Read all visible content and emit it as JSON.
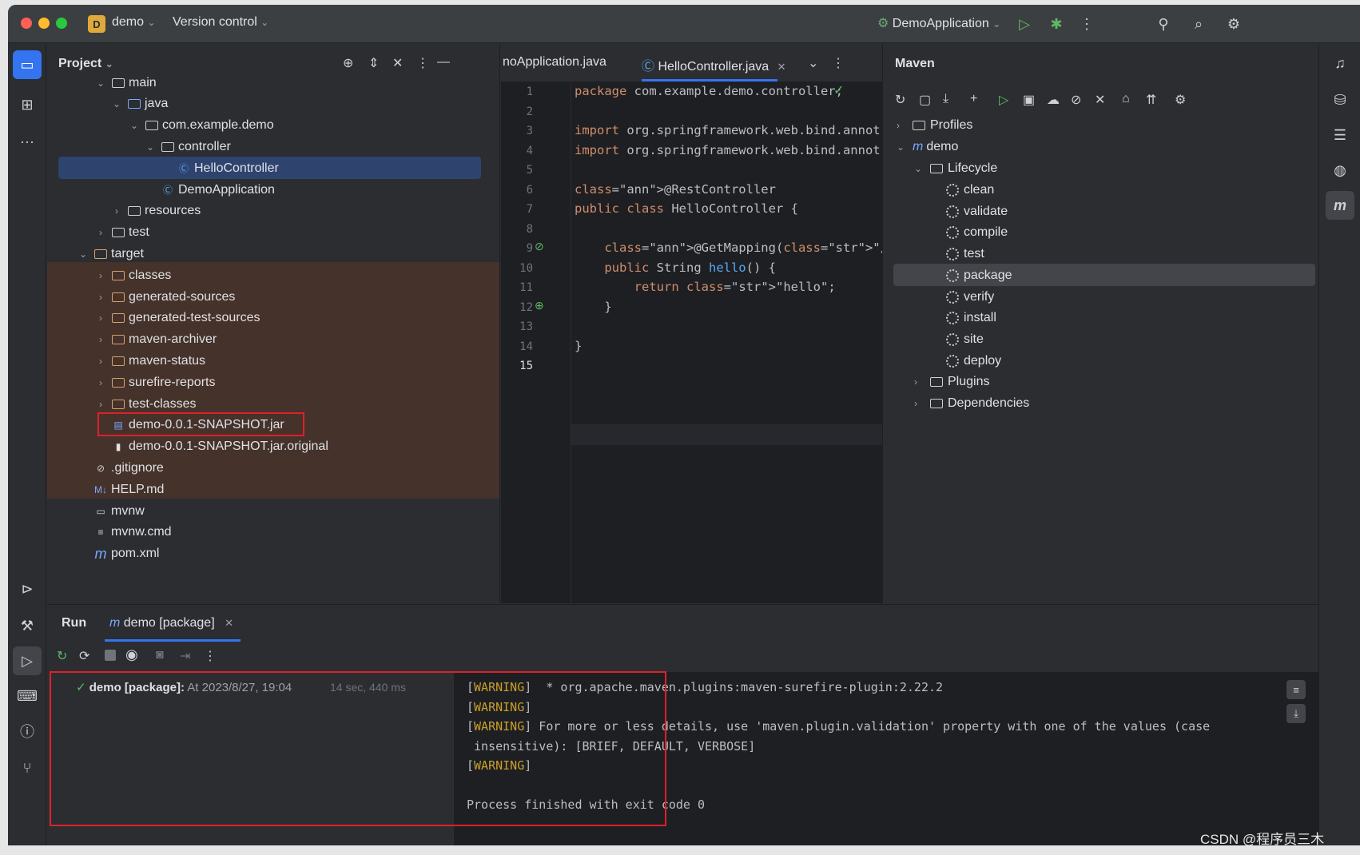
{
  "titlebar": {
    "project_badge": "D",
    "project_name": "demo",
    "vcs": "Version control",
    "run_config": "DemoApplication"
  },
  "project_panel": {
    "title": "Project",
    "tree": [
      {
        "label": "main",
        "indent": 0
      },
      {
        "label": "java",
        "indent": 1
      },
      {
        "label": "com.example.demo",
        "indent": 2
      },
      {
        "label": "controller",
        "indent": 3
      },
      {
        "label": "HelloController",
        "indent": 4,
        "selected": true
      },
      {
        "label": "DemoApplication",
        "indent": 3
      },
      {
        "label": "resources",
        "indent": 1
      },
      {
        "label": "test",
        "indent": 0
      },
      {
        "label": "target",
        "indent": -1
      },
      {
        "label": "classes",
        "indent": 0
      },
      {
        "label": "generated-sources",
        "indent": 0
      },
      {
        "label": "generated-test-sources",
        "indent": 0
      },
      {
        "label": "maven-archiver",
        "indent": 0
      },
      {
        "label": "maven-status",
        "indent": 0
      },
      {
        "label": "surefire-reports",
        "indent": 0
      },
      {
        "label": "test-classes",
        "indent": 0
      },
      {
        "label": "demo-0.0.1-SNAPSHOT.jar",
        "indent": 0
      },
      {
        "label": "demo-0.0.1-SNAPSHOT.jar.original",
        "indent": 0
      },
      {
        "label": ".gitignore",
        "indent": -1
      },
      {
        "label": "HELP.md",
        "indent": -1
      },
      {
        "label": "mvnw",
        "indent": -1
      },
      {
        "label": "mvnw.cmd",
        "indent": -1
      },
      {
        "label": "pom.xml",
        "indent": -1
      }
    ]
  },
  "editor": {
    "tabs": [
      "noApplication.java",
      "HelloController.java"
    ],
    "lines": [
      {
        "n": "1",
        "text": "package com.example.demo.controller;"
      },
      {
        "n": "2",
        "text": ""
      },
      {
        "n": "3",
        "text": "import org.springframework.web.bind.annot"
      },
      {
        "n": "4",
        "text": "import org.springframework.web.bind.annot"
      },
      {
        "n": "5",
        "text": ""
      },
      {
        "n": "6",
        "text": "@RestController"
      },
      {
        "n": "7",
        "text": "public class HelloController {"
      },
      {
        "n": "8",
        "text": ""
      },
      {
        "n": "9",
        "text": "    @GetMapping(\"/hello\")"
      },
      {
        "n": "10",
        "text": "    public String hello() {"
      },
      {
        "n": "11",
        "text": "        return \"hello\";"
      },
      {
        "n": "12",
        "text": "    }"
      },
      {
        "n": "13",
        "text": ""
      },
      {
        "n": "14",
        "text": "}"
      },
      {
        "n": "15",
        "text": ""
      }
    ]
  },
  "maven": {
    "title": "Maven",
    "profiles": "Profiles",
    "project": "demo",
    "lifecycle": "Lifecycle",
    "goals": [
      "clean",
      "validate",
      "compile",
      "test",
      "package",
      "verify",
      "install",
      "site",
      "deploy"
    ],
    "selected_goal": "package",
    "plugins": "Plugins",
    "dependencies": "Dependencies"
  },
  "run": {
    "tab_run": "Run",
    "tab_config": "demo [package]",
    "result_label": "demo [package]:",
    "result_time": "At 2023/8/27, 19:04",
    "duration": "14 sec, 440 ms",
    "console": [
      {
        "tag": "[WARNING]",
        "text": "  * org.apache.maven.plugins:maven-surefire-plugin:2.22.2"
      },
      {
        "tag": "[WARNING]",
        "text": ""
      },
      {
        "tag": "[WARNING]",
        "text": " For more or less details, use 'maven.plugin.validation' property with one of the values (case"
      },
      {
        "tag": "",
        "text": " insensitive): [BRIEF, DEFAULT, VERBOSE]"
      },
      {
        "tag": "[WARNING]",
        "text": ""
      },
      {
        "tag": "",
        "text": ""
      },
      {
        "tag": "",
        "text": "Process finished with exit code 0"
      }
    ]
  },
  "watermark": "CSDN @程序员三木"
}
